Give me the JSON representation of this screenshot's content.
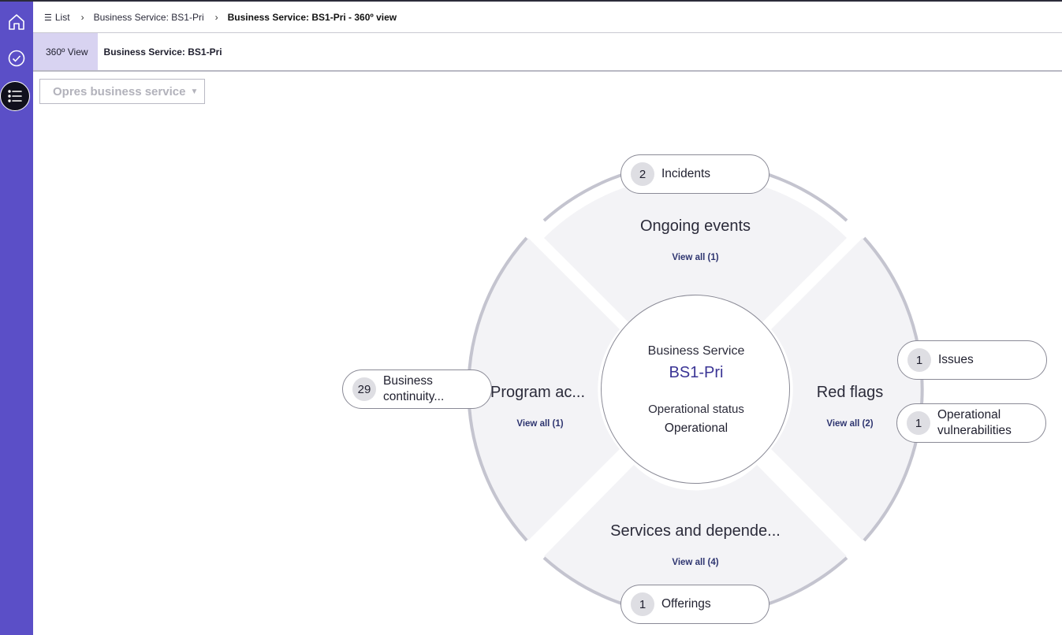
{
  "rail": {
    "items": [
      {
        "name": "home"
      },
      {
        "name": "approvals"
      },
      {
        "name": "list"
      }
    ]
  },
  "breadcrumb": {
    "list_label": "List",
    "item1": "Business Service: BS1-Pri",
    "item2": "Business Service: BS1-Pri - 360º view"
  },
  "tabs": {
    "view_tab": "360º View",
    "record_title": "Business Service: BS1-Pri"
  },
  "dropdown": {
    "value": "Opres business service"
  },
  "wheel": {
    "center": {
      "type_label": "Business Service",
      "name": "BS1-Pri",
      "status_label": "Operational status",
      "status_value": "Operational"
    },
    "segments": {
      "top": {
        "title": "Ongoing events",
        "link": "View all (1)"
      },
      "right": {
        "title": "Red flags",
        "link": "View all (2)"
      },
      "bottom": {
        "title": "Services and depende...",
        "link": "View all (4)"
      },
      "left": {
        "title": "Program ac...",
        "link": "View all (1)"
      }
    },
    "pills": {
      "incidents": {
        "count": "2",
        "label": "Incidents"
      },
      "issues": {
        "count": "1",
        "label": "Issues"
      },
      "vulnerabilities": {
        "count": "1",
        "label": "Operational vulnerabilities"
      },
      "offerings": {
        "count": "1",
        "label": "Offerings"
      },
      "continuity": {
        "count": "29",
        "label": "Business continuity..."
      }
    }
  },
  "colors": {
    "rail": "#5b4fc7",
    "segment_fill": "#f3f3f6",
    "ring": "#c4c4cf",
    "accent_text": "#3a3495"
  }
}
